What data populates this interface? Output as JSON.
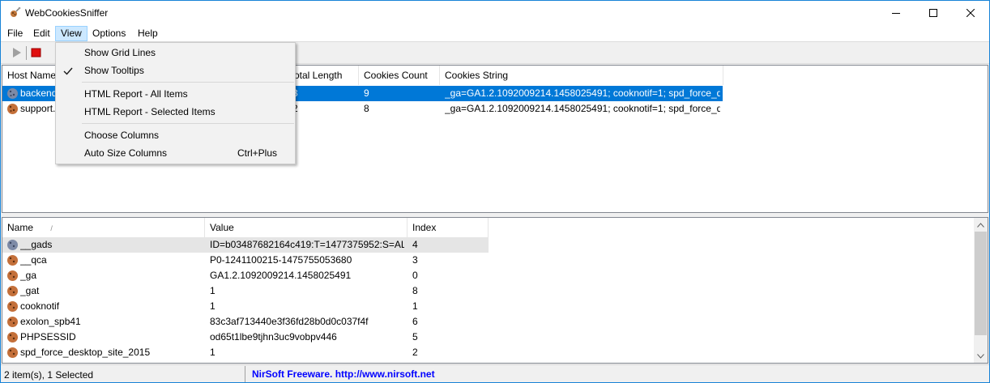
{
  "window": {
    "title": "WebCookiesSniffer"
  },
  "menu": {
    "items": [
      "File",
      "Edit",
      "View",
      "Options",
      "Help"
    ]
  },
  "toolbar": {
    "icons": [
      "play-icon",
      "stop-icon"
    ]
  },
  "upper_list": {
    "columns": [
      "Host Name",
      "Total Length",
      "Cookies Count",
      "Cookies String"
    ],
    "rows": [
      {
        "host": "backend",
        "length": "3",
        "count": "9",
        "string": "_ga=GA1.2.1092009214.1458025491; cooknotif=1; spd_force_de...",
        "selected": true
      },
      {
        "host": "support.",
        "length": "2",
        "count": "8",
        "string": "_ga=GA1.2.1092009214.1458025491; cooknotif=1; spd_force_de...",
        "selected": false
      }
    ]
  },
  "view_menu": {
    "items": [
      {
        "label": "Show Grid Lines",
        "checked": false
      },
      {
        "label": "Show Tooltips",
        "checked": true
      },
      {
        "label": "HTML Report - All Items"
      },
      {
        "label": "HTML Report - Selected Items"
      },
      {
        "label": "Choose Columns"
      },
      {
        "label": "Auto Size Columns",
        "shortcut": "Ctrl+Plus"
      }
    ]
  },
  "lower_list": {
    "columns": [
      "Name",
      "Value",
      "Index"
    ],
    "sort_indicator": "/",
    "rows": [
      {
        "name": "__gads",
        "value": "ID=b03487682164c419:T=1477375952:S=AL...",
        "index": "4"
      },
      {
        "name": "__qca",
        "value": "P0-1241100215-1475755053680",
        "index": "3"
      },
      {
        "name": "_ga",
        "value": "GA1.2.1092009214.1458025491",
        "index": "0"
      },
      {
        "name": "_gat",
        "value": "1",
        "index": "8"
      },
      {
        "name": "cooknotif",
        "value": "1",
        "index": "1"
      },
      {
        "name": "exolon_spb41",
        "value": "83c3af713440e3f36fd28b0d0c037f4f",
        "index": "6"
      },
      {
        "name": "PHPSESSID",
        "value": "od65t1lbe9tjhn3uc9vobpv446",
        "index": "5"
      },
      {
        "name": "spd_force_desktop_site_2015",
        "value": "1",
        "index": "2"
      }
    ]
  },
  "status": {
    "left": "2 item(s), 1 Selected",
    "link": "NirSoft Freeware.  http://www.nirsoft.net"
  },
  "colors": {
    "selection": "#0078d7",
    "menu_active": "#cce8ff",
    "link": "#0000ff"
  }
}
